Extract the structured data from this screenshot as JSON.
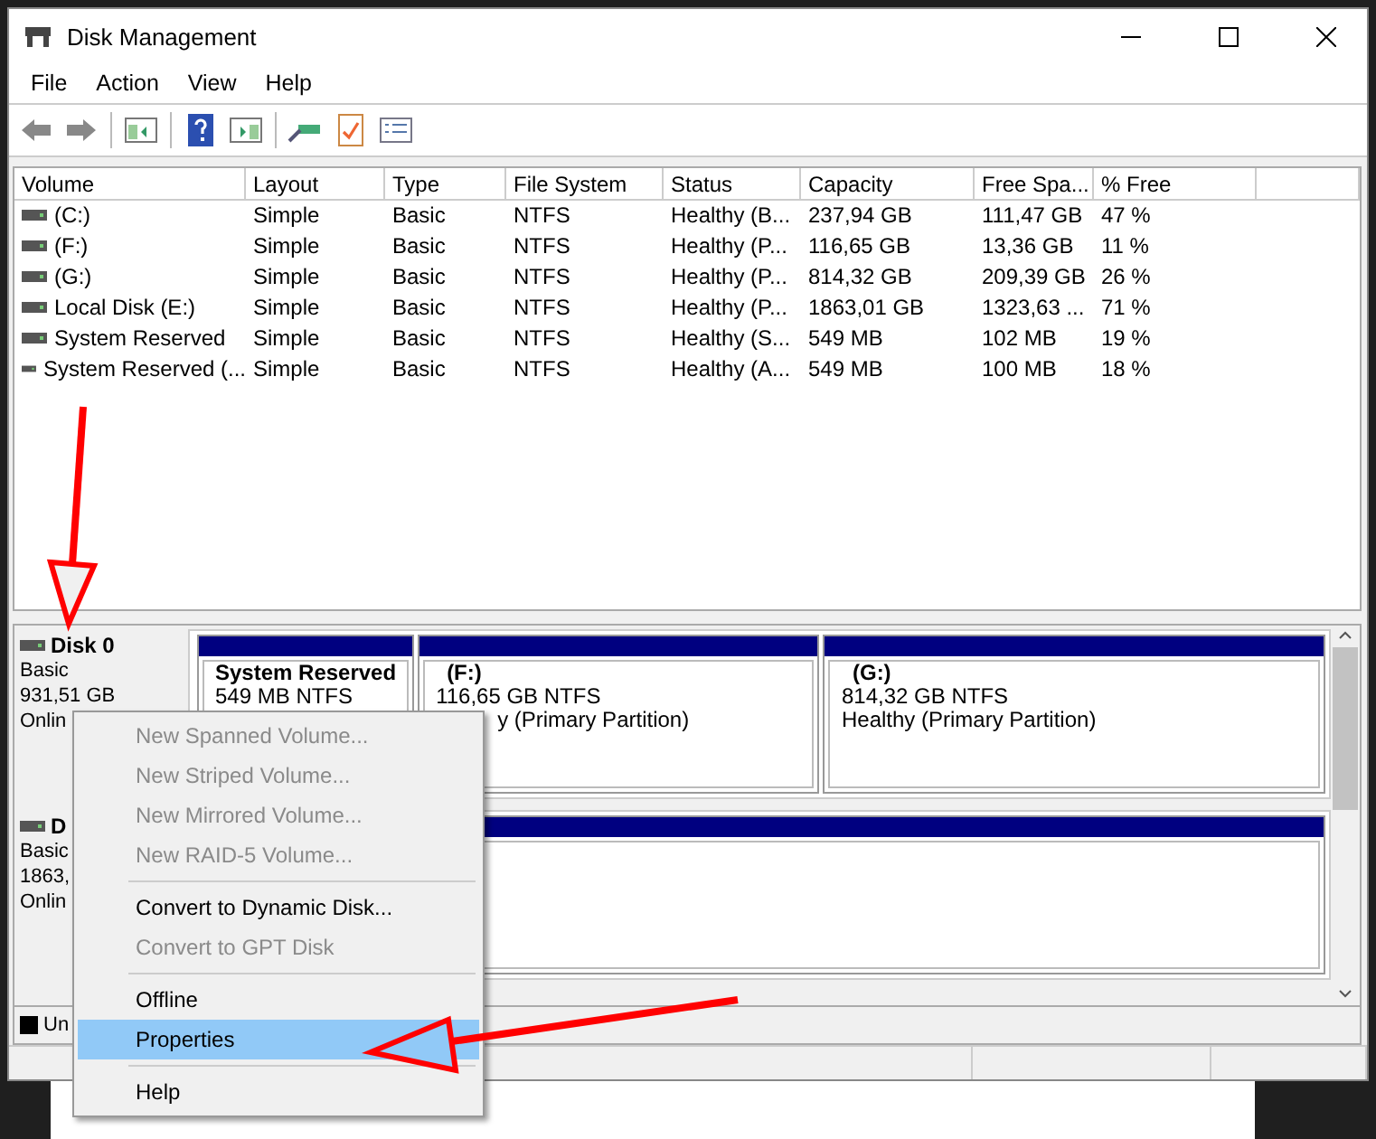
{
  "window": {
    "title": "Disk Management"
  },
  "menu": [
    "File",
    "Action",
    "View",
    "Help"
  ],
  "table": {
    "columns": [
      "Volume",
      "Layout",
      "Type",
      "File System",
      "Status",
      "Capacity",
      "Free Spa...",
      "% Free"
    ],
    "rows": [
      [
        "(C:)",
        "Simple",
        "Basic",
        "NTFS",
        "Healthy (B...",
        "237,94 GB",
        "111,47 GB",
        "47 %"
      ],
      [
        "(F:)",
        "Simple",
        "Basic",
        "NTFS",
        "Healthy (P...",
        "116,65 GB",
        "13,36 GB",
        "11 %"
      ],
      [
        "(G:)",
        "Simple",
        "Basic",
        "NTFS",
        "Healthy (P...",
        "814,32 GB",
        "209,39 GB",
        "26 %"
      ],
      [
        "Local Disk (E:)",
        "Simple",
        "Basic",
        "NTFS",
        "Healthy (P...",
        "1863,01 GB",
        "1323,63 ...",
        "71 %"
      ],
      [
        "System Reserved",
        "Simple",
        "Basic",
        "NTFS",
        "Healthy (S...",
        "549 MB",
        "102 MB",
        "19 %"
      ],
      [
        "System Reserved (...",
        "Simple",
        "Basic",
        "NTFS",
        "Healthy (A...",
        "549 MB",
        "100 MB",
        "18 %"
      ]
    ]
  },
  "disks": [
    {
      "name": "Disk 0",
      "lines": [
        "Basic",
        "931,51 GB",
        "Onlin"
      ],
      "partitions": [
        {
          "kind": "volume",
          "title": "System Reserved",
          "lines": [
            "549 MB NTFS"
          ]
        },
        {
          "kind": "volume",
          "title": "(F:)",
          "lines": [
            "116,65 GB NTFS",
            "y (Primary Partition)"
          ]
        },
        {
          "kind": "volume",
          "title": "(G:)",
          "lines": [
            "814,32 GB NTFS",
            "Healthy (Primary Partition)"
          ]
        }
      ]
    },
    {
      "name": "D",
      "lines": [
        "Basic",
        "1863,",
        "Onlin"
      ],
      "partitions": [
        {
          "kind": "blank"
        }
      ]
    }
  ],
  "legend": {
    "label": "Un"
  },
  "context_menu": {
    "groups": [
      [
        {
          "label": "New Spanned Volume...",
          "disabled": true,
          "selected": false
        },
        {
          "label": "New Striped Volume...",
          "disabled": true,
          "selected": false
        },
        {
          "label": "New Mirrored Volume...",
          "disabled": true,
          "selected": false
        },
        {
          "label": "New RAID-5 Volume...",
          "disabled": true,
          "selected": false
        }
      ],
      [
        {
          "label": "Convert to Dynamic Disk...",
          "disabled": false,
          "selected": false
        },
        {
          "label": "Convert to GPT Disk",
          "disabled": true,
          "selected": false
        }
      ],
      [
        {
          "label": "Offline",
          "disabled": false,
          "selected": false
        },
        {
          "label": "Properties",
          "disabled": false,
          "selected": true
        }
      ],
      [
        {
          "label": "Help",
          "disabled": false,
          "selected": false
        }
      ]
    ]
  }
}
